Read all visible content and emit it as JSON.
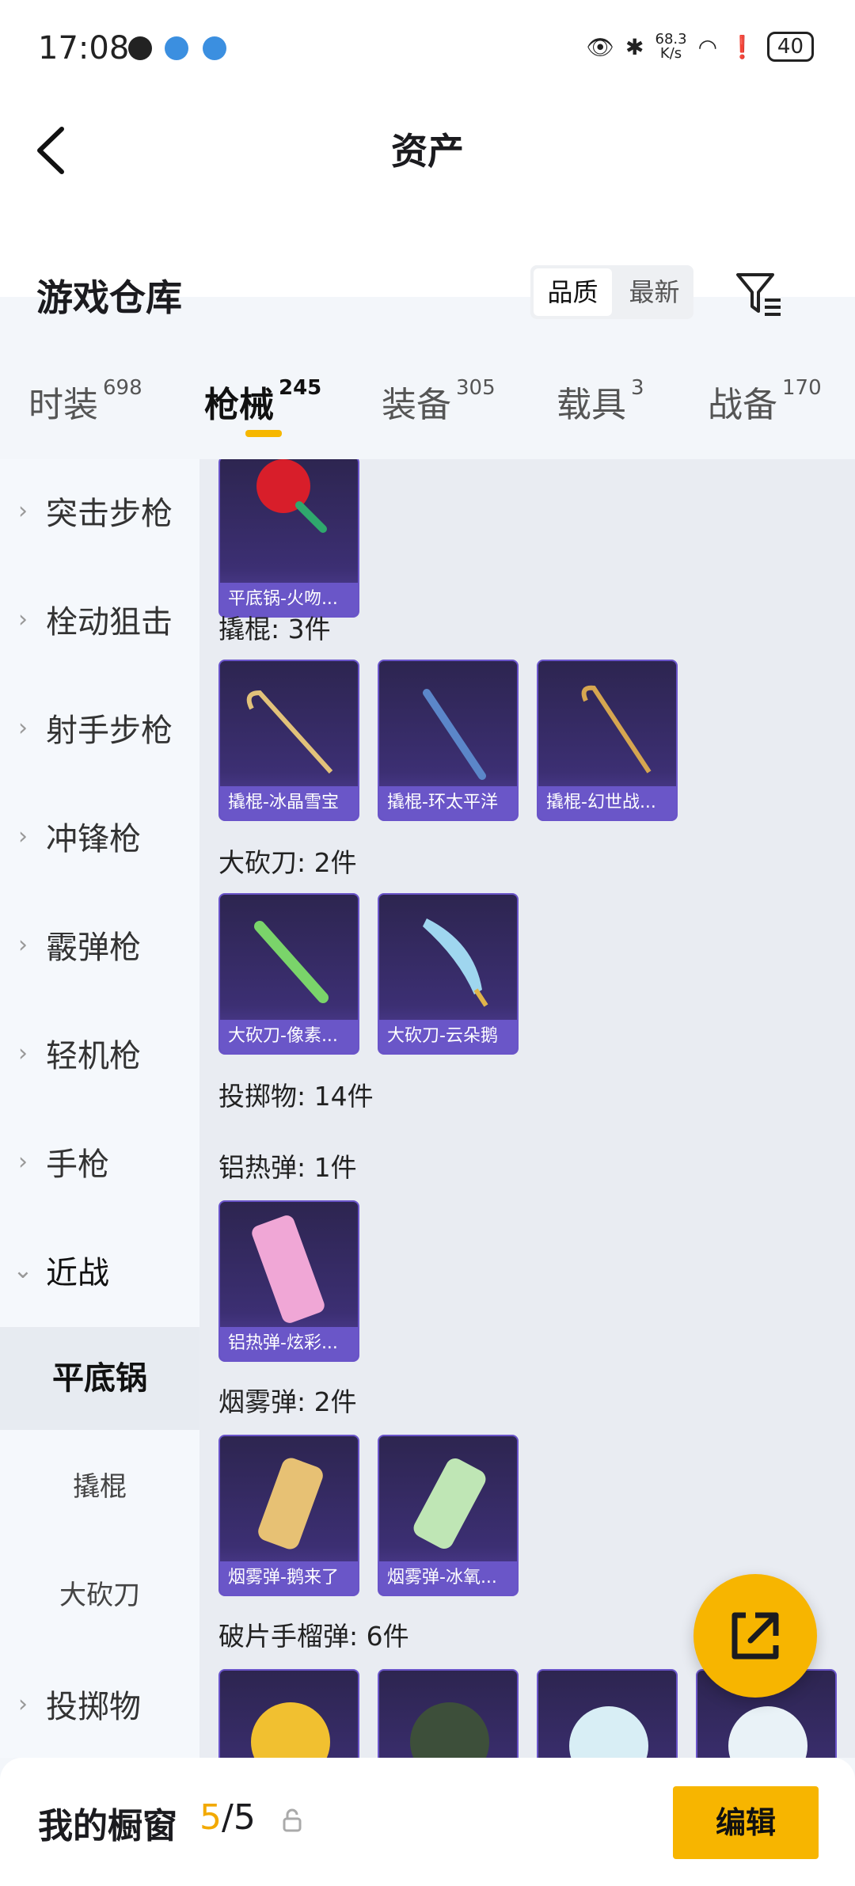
{
  "status_bar": {
    "time": "17:08",
    "net_speed_value": "68.3",
    "net_speed_unit": "K/s",
    "battery": "40"
  },
  "header": {
    "title": "资产",
    "section_title": "游戏仓库",
    "sort_options": [
      "品质",
      "最新"
    ],
    "active_sort": "品质"
  },
  "tabs": [
    {
      "label": "时装",
      "count": "698"
    },
    {
      "label": "枪械",
      "count": "245",
      "active": true
    },
    {
      "label": "装备",
      "count": "305"
    },
    {
      "label": "载具",
      "count": "3"
    },
    {
      "label": "战备",
      "count": "170"
    }
  ],
  "sidebar": {
    "items": [
      {
        "label": "突击步枪"
      },
      {
        "label": "栓动狙击"
      },
      {
        "label": "射手步枪"
      },
      {
        "label": "冲锋枪"
      },
      {
        "label": "霰弹枪"
      },
      {
        "label": "轻机枪"
      },
      {
        "label": "手枪"
      },
      {
        "label": "近战",
        "expanded": true
      }
    ],
    "sub_items": [
      "平底锅",
      "撬棍",
      "大砍刀"
    ],
    "active_sub": "平底锅",
    "after_items": [
      {
        "label": "投掷物"
      }
    ]
  },
  "main": {
    "groups": [
      {
        "label": "撬棍: 3件"
      },
      {
        "label": "大砍刀: 2件"
      },
      {
        "label": "投掷物: 14件"
      },
      {
        "label": "铝热弹: 1件"
      },
      {
        "label": "烟雾弹: 2件"
      },
      {
        "label": "破片手榴弹: 6件"
      }
    ],
    "items": [
      {
        "name": "平底锅-火吻..."
      },
      {
        "name": "撬棍-冰晶雪宝"
      },
      {
        "name": "撬棍-环太平洋"
      },
      {
        "name": "撬棍-幻世战..."
      },
      {
        "name": "大砍刀-像素..."
      },
      {
        "name": "大砍刀-云朵鹅"
      },
      {
        "name": "铝热弹-炫彩..."
      },
      {
        "name": "烟雾弹-鹅来了"
      },
      {
        "name": "烟雾弹-冰氧..."
      }
    ]
  },
  "bottom_bar": {
    "title": "我的橱窗",
    "current": "5",
    "total": "/5",
    "edit_label": "编辑"
  },
  "colors": {
    "accent": "#f7b500",
    "card_bg": "#3c2f73",
    "card_caption": "#6a56c8"
  }
}
